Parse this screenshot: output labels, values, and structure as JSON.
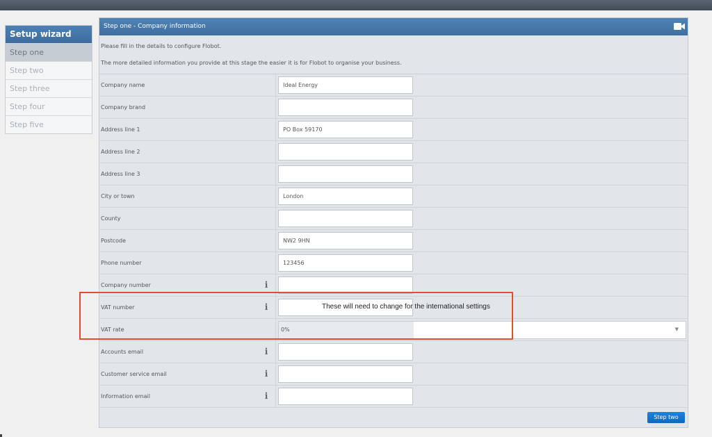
{
  "sidebar": {
    "title": "Setup wizard",
    "items": [
      {
        "label": "Step one",
        "active": true
      },
      {
        "label": "Step two",
        "active": false
      },
      {
        "label": "Step three",
        "active": false
      },
      {
        "label": "Step four",
        "active": false
      },
      {
        "label": "Step five",
        "active": false
      }
    ]
  },
  "panel": {
    "title": "Step one - Company information",
    "intro": [
      "Please fill in the details to configure Flobot.",
      "The more detailed information you provide at this stage the easier it is for Flobot to organise your business."
    ],
    "fields": [
      {
        "label": "Company name",
        "value": "Ideal Energy",
        "info": false
      },
      {
        "label": "Company brand",
        "value": "",
        "info": false
      },
      {
        "label": "Address line 1",
        "value": "PO Box 59170",
        "info": false
      },
      {
        "label": "Address line 2",
        "value": "",
        "info": false
      },
      {
        "label": "Address line 3",
        "value": "",
        "info": false
      },
      {
        "label": "City or town",
        "value": "London",
        "info": false
      },
      {
        "label": "County",
        "value": "",
        "info": false
      },
      {
        "label": "Postcode",
        "value": "NW2 9HN",
        "info": false
      },
      {
        "label": "Phone number",
        "value": "123456",
        "info": false
      },
      {
        "label": "Company number",
        "value": "",
        "info": true
      },
      {
        "label": "VAT number",
        "value": "",
        "info": true
      },
      {
        "label": "VAT rate",
        "value": "0%",
        "type": "select",
        "info": false
      },
      {
        "label": "Accounts email",
        "value": "",
        "info": true
      },
      {
        "label": "Customer service email",
        "value": "",
        "info": true
      },
      {
        "label": "Information email",
        "value": "",
        "info": true
      }
    ],
    "next_button": "Step two"
  },
  "icons": {
    "header": "video-camera-icon",
    "info": "info-icon",
    "select": "chevron-down-icon"
  },
  "annotation": {
    "text": "These will need to change for the international settings",
    "color": "#e44b33"
  }
}
